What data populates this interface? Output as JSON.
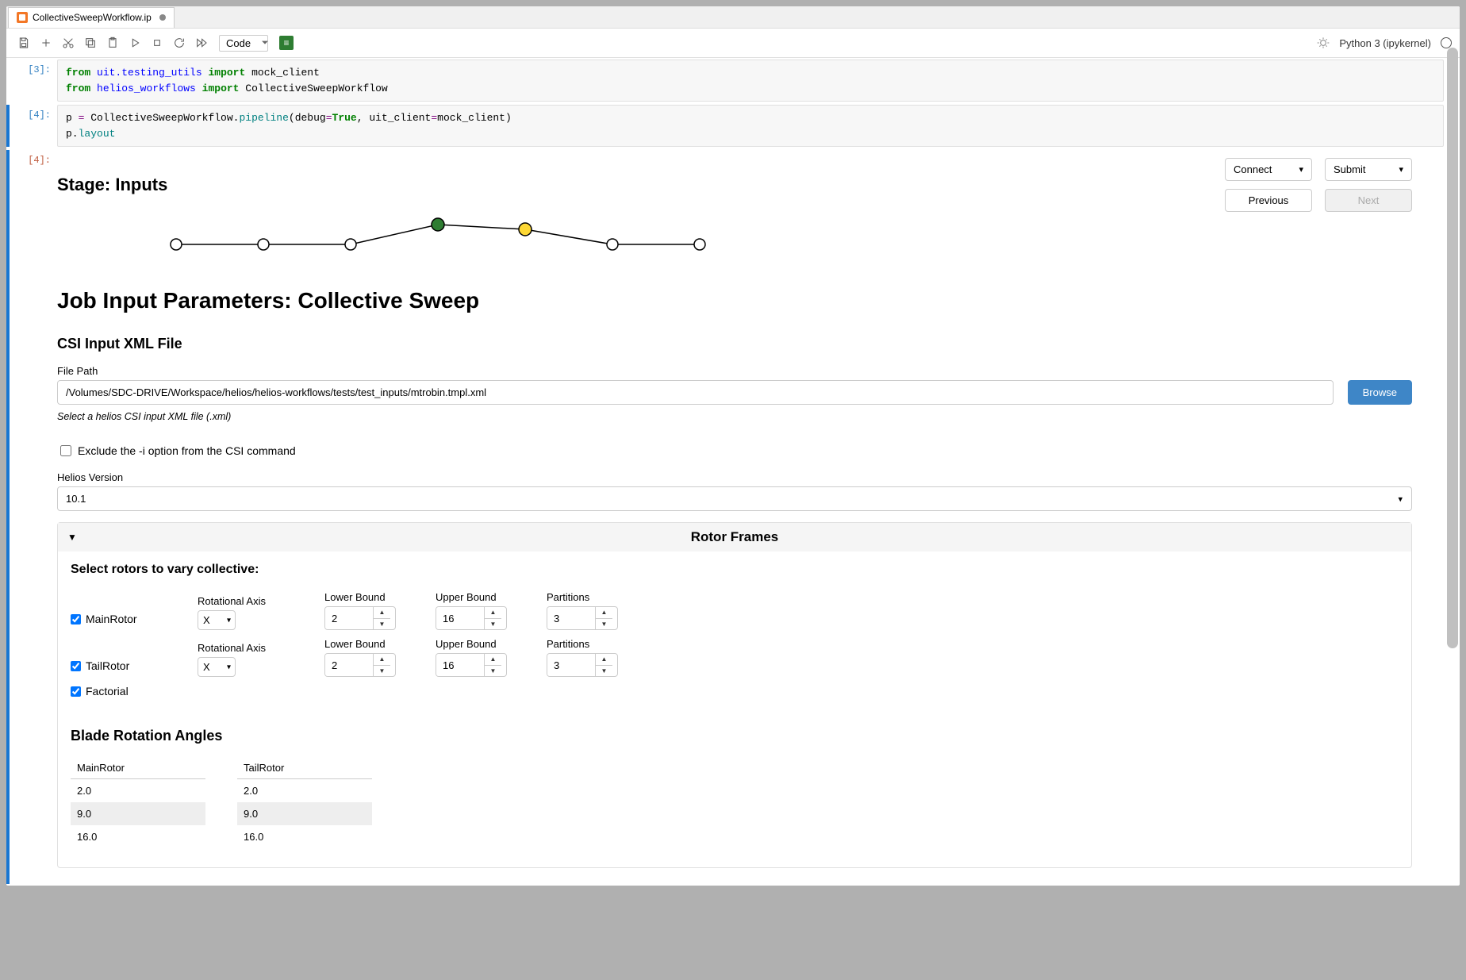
{
  "tab": {
    "title": "CollectiveSweepWorkflow.ip"
  },
  "toolbar": {
    "celltype": "Code",
    "kernel": "Python 3 (ipykernel)"
  },
  "cells": {
    "c1": {
      "prompt": "[3]:",
      "line1a": "from",
      "line1b": "uit.testing_utils",
      "line1c": "import",
      "line1d": "mock_client",
      "line2a": "from",
      "line2b": "helios_workflows",
      "line2c": "import",
      "line2d": "CollectiveSweepWorkflow"
    },
    "c2": {
      "prompt": "[4]:",
      "line1a": "p ",
      "line1b": "=",
      "line1c": " CollectiveSweepWorkflow.",
      "line1d": "pipeline",
      "line1e": "(debug",
      "line1f": "=",
      "line1g": "True",
      "line1h": ", uit_client",
      "line1i": "=",
      "line1j": "mock_client)",
      "line2a": "p.",
      "line2b": "layout"
    },
    "out_prompt": "[4]:"
  },
  "stage": {
    "title": "Stage: Inputs",
    "connect": "Connect",
    "submit": "Submit",
    "previous": "Previous",
    "next": "Next"
  },
  "inputs": {
    "heading": "Job Input Parameters: Collective Sweep",
    "csi_heading": "CSI Input XML File",
    "filepath_label": "File Path",
    "filepath_value": "/Volumes/SDC-DRIVE/Workspace/helios/helios-workflows/tests/test_inputs/mtrobin.tmpl.xml",
    "browse": "Browse",
    "hint": "Select a helios CSI input XML file (.xml)",
    "exclude_label": "Exclude the -i option from the CSI command",
    "helios_label": "Helios Version",
    "helios_value": "10.1"
  },
  "rotor": {
    "panel_title": "Rotor Frames",
    "select_label": "Select rotors to vary collective:",
    "axis_label": "Rotational Axis",
    "lb_label": "Lower Bound",
    "ub_label": "Upper Bound",
    "part_label": "Partitions",
    "rows": [
      {
        "name": "MainRotor",
        "axis": "X",
        "lb": "2",
        "ub": "16",
        "part": "3"
      },
      {
        "name": "TailRotor",
        "axis": "X",
        "lb": "2",
        "ub": "16",
        "part": "3"
      }
    ],
    "factorial": "Factorial"
  },
  "angles": {
    "heading": "Blade Rotation Angles",
    "cols": [
      {
        "name": "MainRotor",
        "vals": [
          "2.0",
          "9.0",
          "16.0"
        ]
      },
      {
        "name": "TailRotor",
        "vals": [
          "2.0",
          "9.0",
          "16.0"
        ]
      }
    ]
  }
}
